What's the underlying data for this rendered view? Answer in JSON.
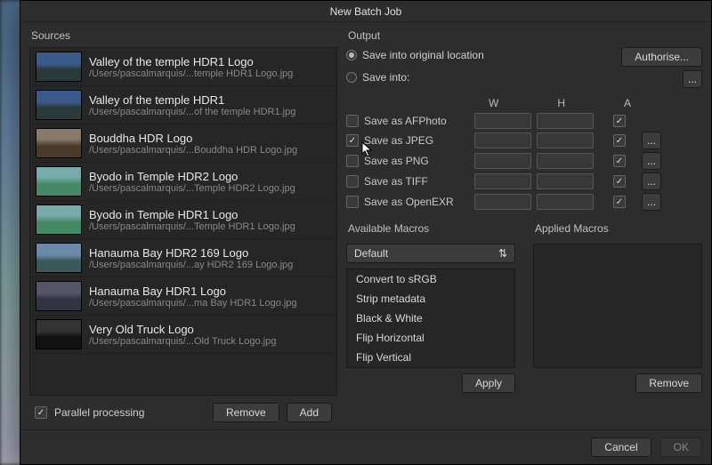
{
  "title": "New Batch Job",
  "sources": {
    "label": "Sources",
    "items": [
      {
        "title": "Valley of the temple HDR1 Logo",
        "path": "/Users/pascalmarquis/...temple HDR1 Logo.jpg",
        "thumb": "a"
      },
      {
        "title": "Valley of the temple HDR1",
        "path": "/Users/pascalmarquis/...of the temple HDR1.jpg",
        "thumb": "a"
      },
      {
        "title": "Bouddha HDR Logo",
        "path": "/Users/pascalmarquis/...Bouddha HDR Logo.jpg",
        "thumb": "b"
      },
      {
        "title": "Byodo in Temple HDR2 Logo",
        "path": "/Users/pascalmarquis/...Temple HDR2 Logo.jpg",
        "thumb": "c"
      },
      {
        "title": "Byodo in Temple HDR1 Logo",
        "path": "/Users/pascalmarquis/...Temple HDR1 Logo.jpg",
        "thumb": "c"
      },
      {
        "title": "Hanauma Bay HDR2 169 Logo",
        "path": "/Users/pascalmarquis/...ay HDR2 169 Logo.jpg",
        "thumb": "d"
      },
      {
        "title": "Hanauma Bay HDR1 Logo",
        "path": "/Users/pascalmarquis/...ma Bay HDR1 Logo.jpg",
        "thumb": "e"
      },
      {
        "title": "Very Old Truck Logo",
        "path": "/Users/pascalmarquis/...Old Truck Logo.jpg",
        "thumb": "f"
      }
    ],
    "parallel_label": "Parallel processing",
    "parallel_checked": true,
    "remove_label": "Remove",
    "add_label": "Add"
  },
  "output": {
    "label": "Output",
    "radio_original": "Save into original location",
    "radio_into": "Save into:",
    "radio_selected": "original",
    "authorise_label": "Authorise...",
    "browse_label": "...",
    "head_w": "W",
    "head_h": "H",
    "head_a": "A",
    "formats": [
      {
        "key": "afphoto",
        "label": "Save as AFPhoto",
        "checked": false,
        "a": true,
        "more": false
      },
      {
        "key": "jpeg",
        "label": "Save as JPEG",
        "checked": true,
        "a": true,
        "more": true
      },
      {
        "key": "png",
        "label": "Save as PNG",
        "checked": false,
        "a": true,
        "more": true
      },
      {
        "key": "tiff",
        "label": "Save as TIFF",
        "checked": false,
        "a": true,
        "more": true
      },
      {
        "key": "openexr",
        "label": "Save as OpenEXR",
        "checked": false,
        "a": true,
        "more": true
      }
    ]
  },
  "macros": {
    "available_label": "Available Macros",
    "applied_label": "Applied Macros",
    "select_value": "Default",
    "items": [
      "Convert to sRGB",
      "Strip metadata",
      "Black & White",
      "Flip Horizontal",
      "Flip Vertical"
    ],
    "apply_label": "Apply",
    "remove_label": "Remove"
  },
  "buttons": {
    "cancel": "Cancel",
    "ok": "OK"
  }
}
